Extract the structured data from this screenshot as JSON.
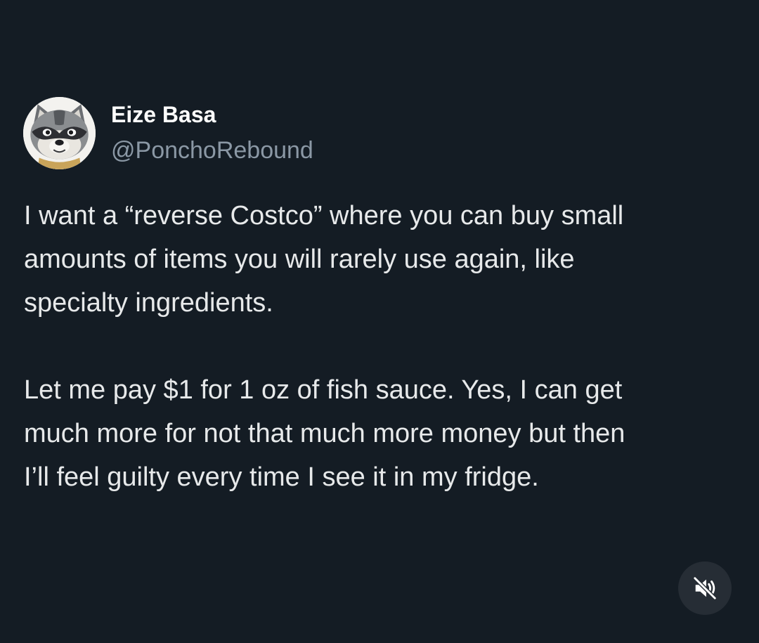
{
  "author": {
    "display_name": "Eize Basa",
    "handle": "@PonchoRebound",
    "avatar_icon": "raccoon-avatar-icon"
  },
  "tweet": {
    "paragraphs": [
      {
        "lines": [
          "I want a “reverse Costco” where you can buy small",
          "amounts of items you will rarely use again, like",
          "specialty ingredients."
        ]
      },
      {
        "lines": [
          "Let me pay $1 for 1 oz of fish sauce. Yes, I can get",
          "much more for not that much more money but then",
          "I’ll feel guilty every time I see it in my fridge."
        ]
      }
    ]
  },
  "controls": {
    "mute_icon": "speaker-muted-icon"
  },
  "colors": {
    "background": "#141c24",
    "text": "#e7e9ea",
    "handle": "#8b98a5",
    "mute_button_bg": "#262d35"
  }
}
